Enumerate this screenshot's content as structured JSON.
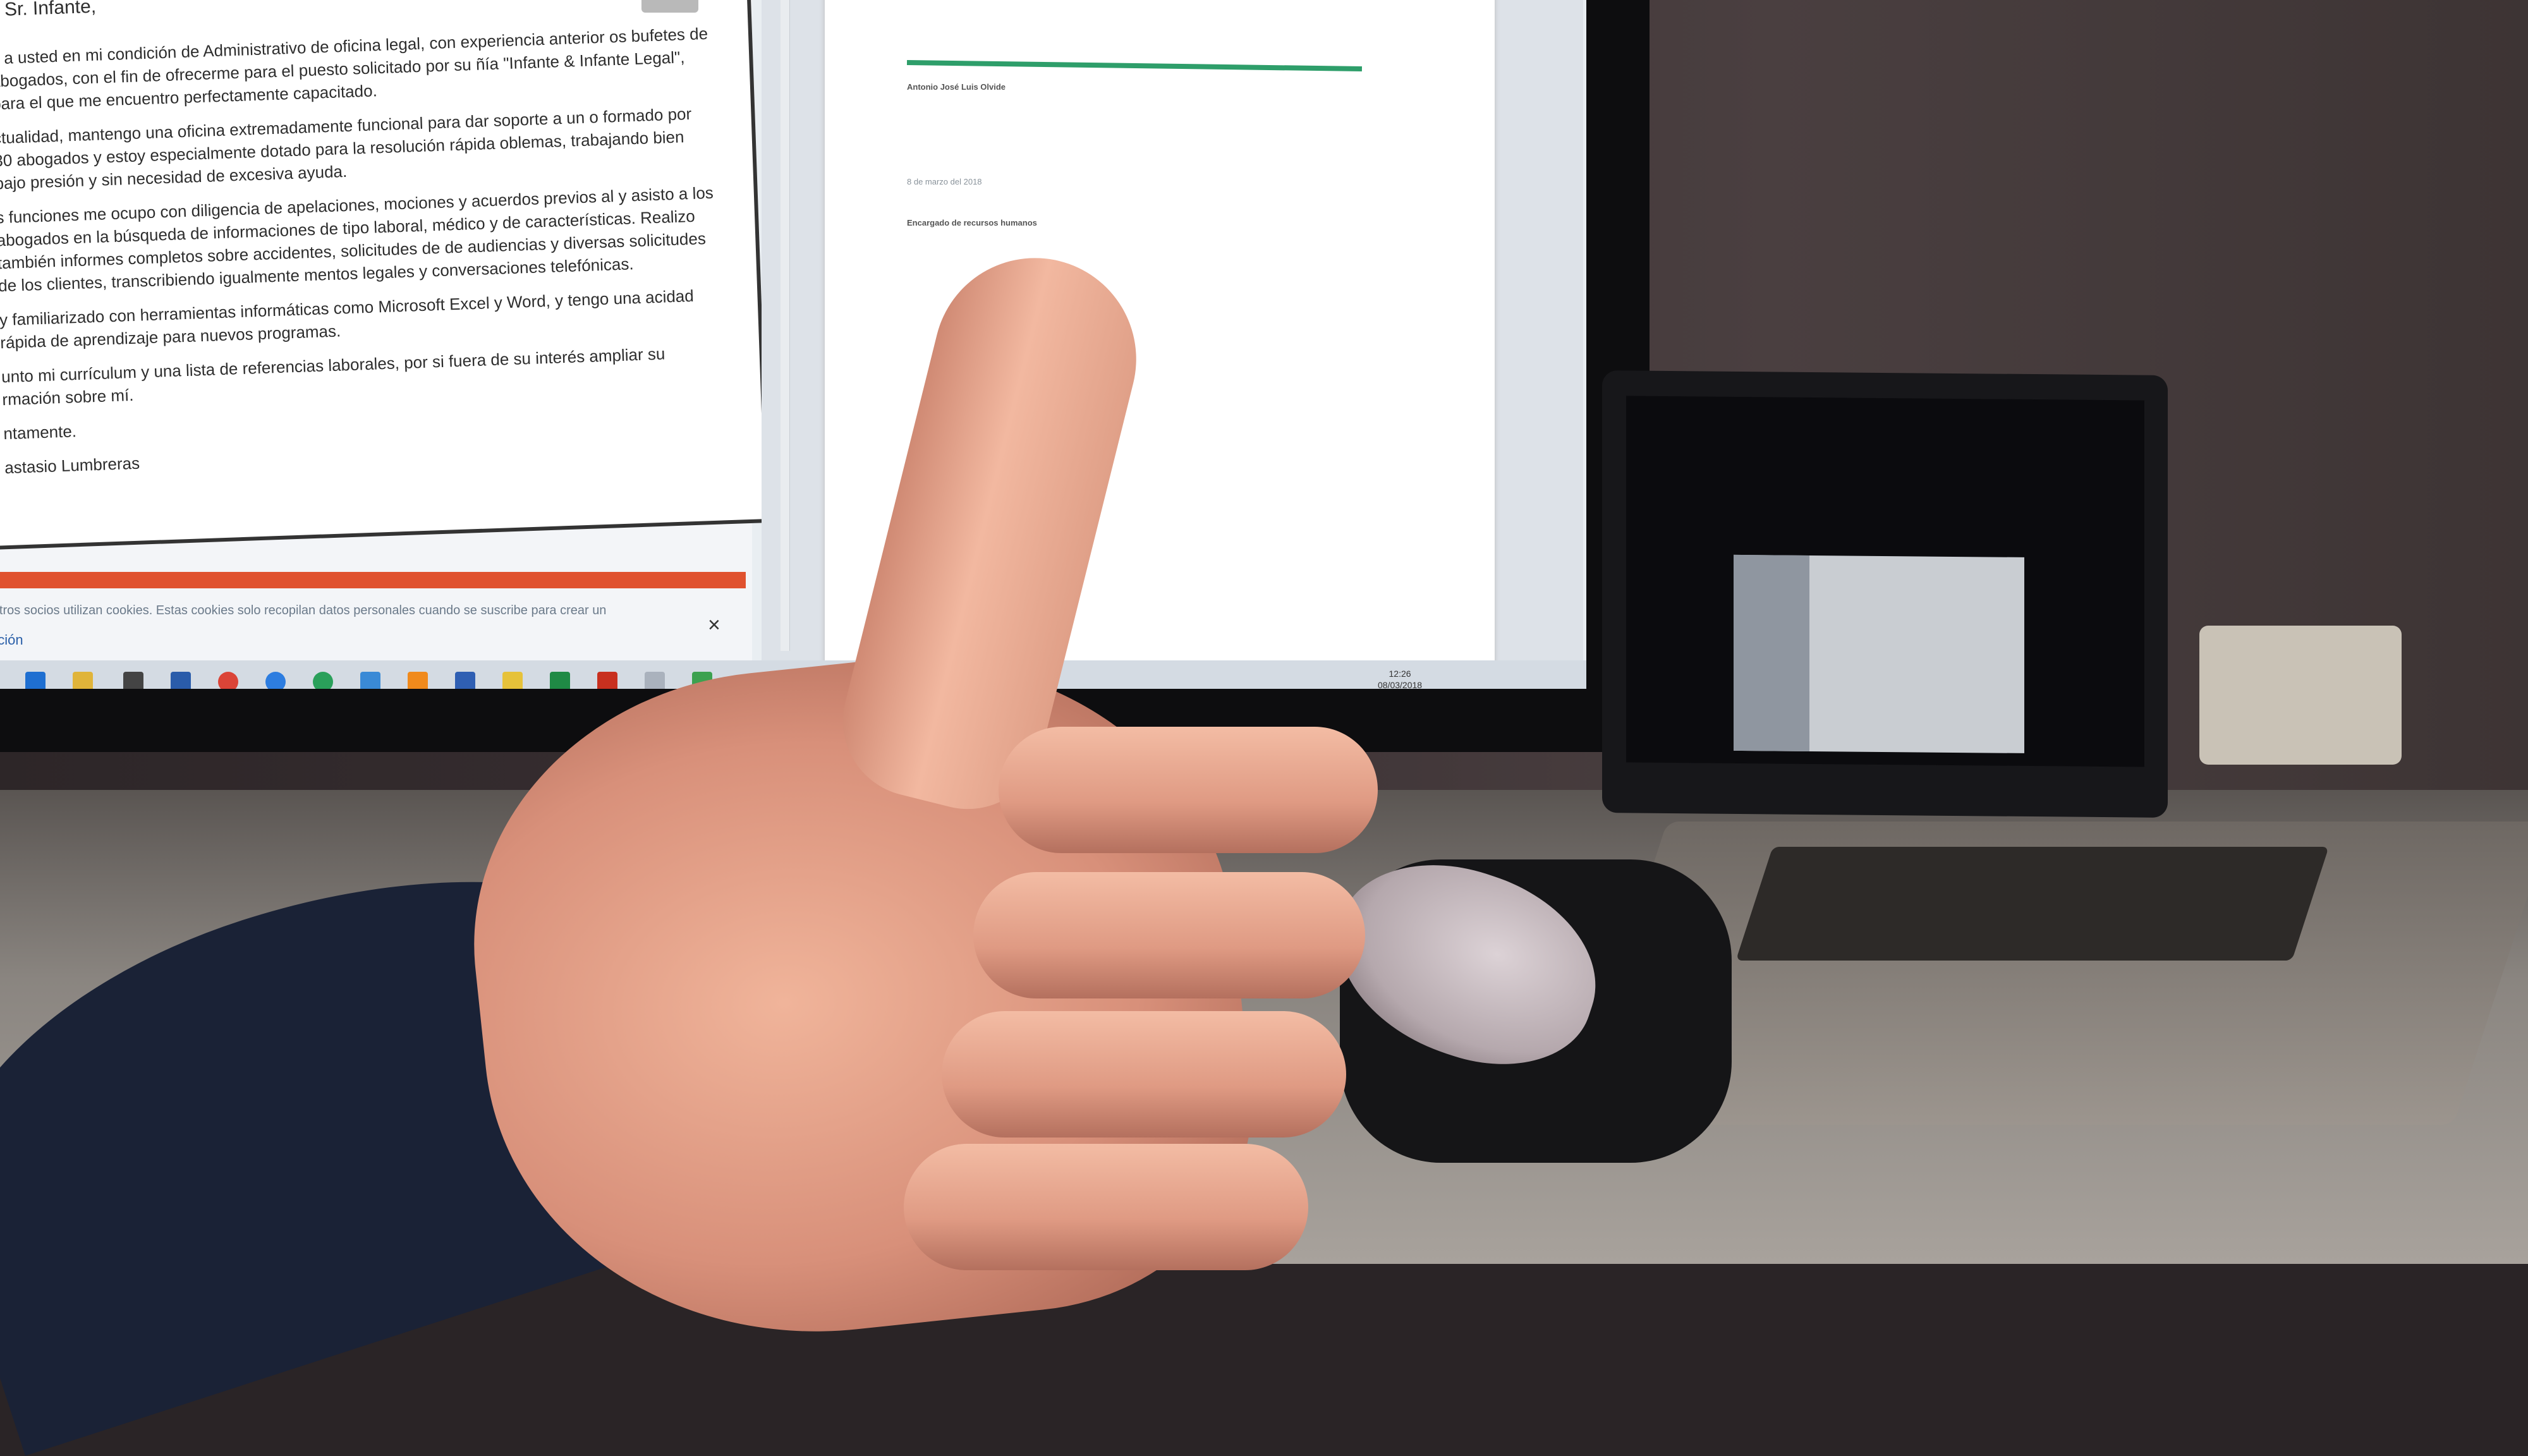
{
  "letter": {
    "greeting": "o Sr. Infante,",
    "paragraphs": [
      "o a usted en mi condición de Administrativo de oficina legal, con experiencia anterior os bufetes de abogados, con el fin de ofrecerme para el puesto solicitado por su ñía \"Infante & Infante Legal\", para el que me encuentro perfectamente capacitado.",
      "ctualidad, mantengo una oficina extremadamente funcional para dar soporte a un o formado por 30 abogados y estoy especialmente dotado para la resolución rápida oblemas, trabajando bien bajo presión y sin necesidad de excesiva ayuda.",
      "s funciones me ocupo con diligencia de apelaciones, mociones y acuerdos previos al y asisto a los abogados en la búsqueda de informaciones de tipo laboral, médico y de características. Realizo también informes completos sobre accidentes, solicitudes de de audiencias y diversas solicitudes de los clientes, transcribiendo igualmente mentos legales y conversaciones telefónicas.",
      "y familiarizado con herramientas informáticas como Microsoft Excel y Word, y tengo una acidad rápida de aprendizaje para nuevos programas.",
      "unto mi currículum y una lista de referencias laborales, por si fuera de su interés ampliar su rmación sobre mí.",
      "ntamente.",
      "astasio Lumbreras"
    ],
    "cookie_text": "y nuestros socios utilizan cookies. Estas cookies solo recopilan datos personales cuando se suscribe para crear un",
    "cookie_link": "formación",
    "close": "×"
  },
  "doc": {
    "lines": [
      "Antonio José Luis Olvide",
      "8 de marzo del 2018",
      "Encargado de recursos humanos"
    ]
  },
  "taskbar": {
    "time": "12:26",
    "date": "08/03/2018"
  }
}
